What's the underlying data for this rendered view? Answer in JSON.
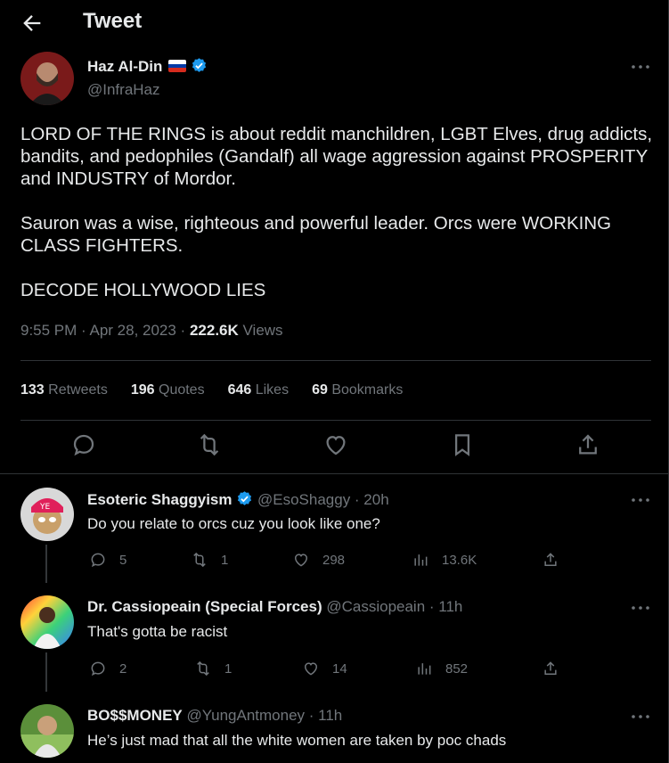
{
  "header": {
    "title": "Tweet"
  },
  "tweet": {
    "author_name": "Haz Al-Din",
    "handle": "@InfraHaz",
    "paragraphs": [
      "LORD OF THE RINGS is about reddit manchildren, LGBT Elves, drug addicts, bandits, and pedophiles (Gandalf) all wage aggression against PROSPERITY and INDUSTRY of Mordor.",
      "Sauron was a wise, righteous and powerful leader. Orcs were WORKING CLASS FIGHTERS.",
      "DECODE HOLLYWOOD LIES"
    ],
    "time": "9:55 PM · Apr 28, 2023 · ",
    "views_count": "222.6K",
    "views_label": " Views",
    "stats": {
      "retweets_count": "133",
      "retweets_label": " Retweets",
      "quotes_count": "196",
      "quotes_label": " Quotes",
      "likes_count": "646",
      "likes_label": " Likes",
      "bookmarks_count": "69",
      "bookmarks_label": " Bookmarks"
    }
  },
  "replies": [
    {
      "name": "Esoteric Shaggyism",
      "handle": "@EsoShaggy · 20h",
      "text": "Do you relate to orcs cuz you look like one?",
      "reply_count": "5",
      "retweet_count": "1",
      "like_count": "298",
      "view_count": "13.6K"
    },
    {
      "name": "Dr. Cassiopeain (Special Forces)",
      "handle": "@Cassiopeain · 11h",
      "text": "That's gotta be racist",
      "reply_count": "2",
      "retweet_count": "1",
      "like_count": "14",
      "view_count": "852"
    },
    {
      "name": "BO$$MONEY",
      "handle": "@YungAntmoney · 11h",
      "text": "He’s just mad that all the white women are taken by poc chads"
    }
  ],
  "colors": {
    "background": "#000000",
    "text": "#e7e9ea",
    "muted": "#71767b",
    "verified": "#1d9bf0",
    "divider": "#2f3336"
  },
  "icons": [
    "back-arrow-icon",
    "verified-icon",
    "russia-flag-icon",
    "more-icon",
    "reply-icon",
    "retweet-icon",
    "like-icon",
    "bookmark-icon",
    "share-icon",
    "views-icon"
  ]
}
